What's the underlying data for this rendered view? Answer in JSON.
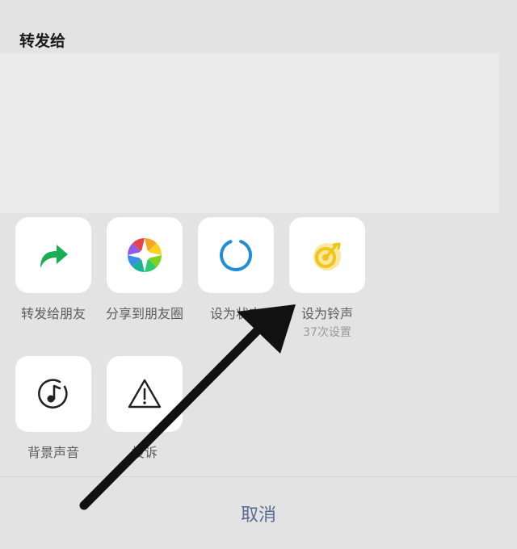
{
  "sheet": {
    "title": "转发给"
  },
  "actions": [
    {
      "label": "转发给朋友",
      "icon": "forward-arrow-icon",
      "color": "#1aad53"
    },
    {
      "label": "分享到朋友圈",
      "icon": "moments-icon",
      "color": "multicolor"
    },
    {
      "label": "设为状态",
      "icon": "status-ring-icon",
      "color": "#1e8ed6"
    },
    {
      "label": "设为铃声",
      "sublabel": "37次设置",
      "icon": "ringtone-icon",
      "color": "#f0c419"
    },
    {
      "label": "背景声音",
      "icon": "music-note-icon",
      "color": "#222222"
    },
    {
      "label": "投诉",
      "icon": "warning-icon",
      "color": "#222222"
    }
  ],
  "footer": {
    "cancel_label": "取消"
  },
  "colors": {
    "accent_link": "#576b95",
    "background": "#e3e3e3"
  }
}
